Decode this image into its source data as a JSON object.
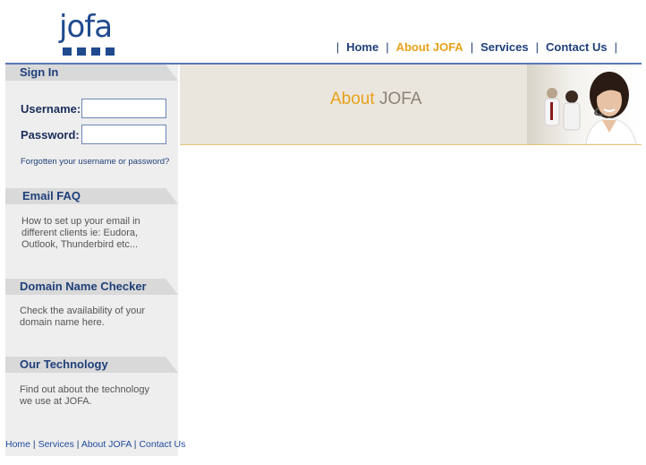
{
  "logo": {
    "text": "jofa"
  },
  "nav": {
    "items": [
      {
        "label": "Home"
      },
      {
        "label": "About JOFA",
        "active": true
      },
      {
        "label": "Services"
      },
      {
        "label": "Contact Us"
      }
    ],
    "separator": "|"
  },
  "signin": {
    "heading": "Sign In",
    "username_label": "Username:",
    "password_label": "Password:",
    "username_value": "",
    "password_value": "",
    "forgot_link": "Forgotten your username or password?"
  },
  "email_faq": {
    "heading": "Email FAQ",
    "text": "How to set up your email in different clients ie: Eudora, Outlook, Thunderbird etc..."
  },
  "domain_checker": {
    "heading": "Domain Name Checker",
    "text": "Check the availability of your domain name here."
  },
  "technology": {
    "heading": "Our Technology",
    "text": "Find out about the technology we use at JOFA."
  },
  "footer": {
    "links": [
      "Home",
      "Services",
      "About JOFA",
      "Contact Us"
    ],
    "separator": " | "
  },
  "banner": {
    "title_part1": "About ",
    "title_part2": "JOFA"
  },
  "colors": {
    "brand_blue": "#1f4a8e",
    "accent_orange": "#e8a21a"
  }
}
